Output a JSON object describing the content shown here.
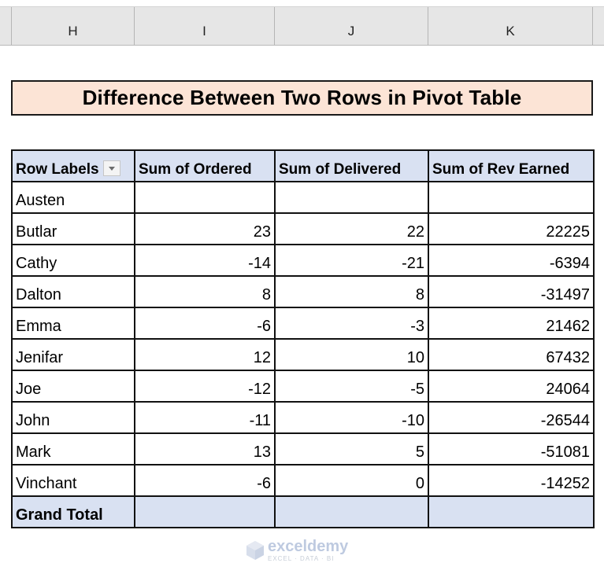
{
  "spreadsheet": {
    "column_headers": [
      "H",
      "I",
      "J",
      "K"
    ]
  },
  "title": "Difference Between Two Rows in Pivot Table",
  "pivot": {
    "headers": [
      "Row Labels",
      "Sum of Ordered",
      "Sum of Delivered",
      "Sum of Rev Earned"
    ],
    "rows": [
      {
        "label": "Austen",
        "ordered": "",
        "delivered": "",
        "rev": ""
      },
      {
        "label": "Butlar",
        "ordered": "23",
        "delivered": "22",
        "rev": "22225"
      },
      {
        "label": "Cathy",
        "ordered": "-14",
        "delivered": "-21",
        "rev": "-6394"
      },
      {
        "label": "Dalton",
        "ordered": "8",
        "delivered": "8",
        "rev": "-31497"
      },
      {
        "label": "Emma",
        "ordered": "-6",
        "delivered": "-3",
        "rev": "21462"
      },
      {
        "label": "Jenifar",
        "ordered": "12",
        "delivered": "10",
        "rev": "67432"
      },
      {
        "label": "Joe",
        "ordered": "-12",
        "delivered": "-5",
        "rev": "24064"
      },
      {
        "label": "John",
        "ordered": "-11",
        "delivered": "-10",
        "rev": "-26544"
      },
      {
        "label": "Mark",
        "ordered": "13",
        "delivered": "5",
        "rev": "-51081"
      },
      {
        "label": "Vinchant",
        "ordered": "-6",
        "delivered": "0",
        "rev": "-14252"
      }
    ],
    "grand_total": {
      "label": "Grand Total",
      "ordered": "",
      "delivered": "",
      "rev": ""
    }
  },
  "watermark": {
    "name": "exceldemy",
    "tagline": "EXCEL · DATA · BI"
  },
  "colors": {
    "title_fill": "#fce4d6",
    "pivot_header_fill": "#d9e1f2",
    "column_header_fill": "#e6e6e6"
  }
}
